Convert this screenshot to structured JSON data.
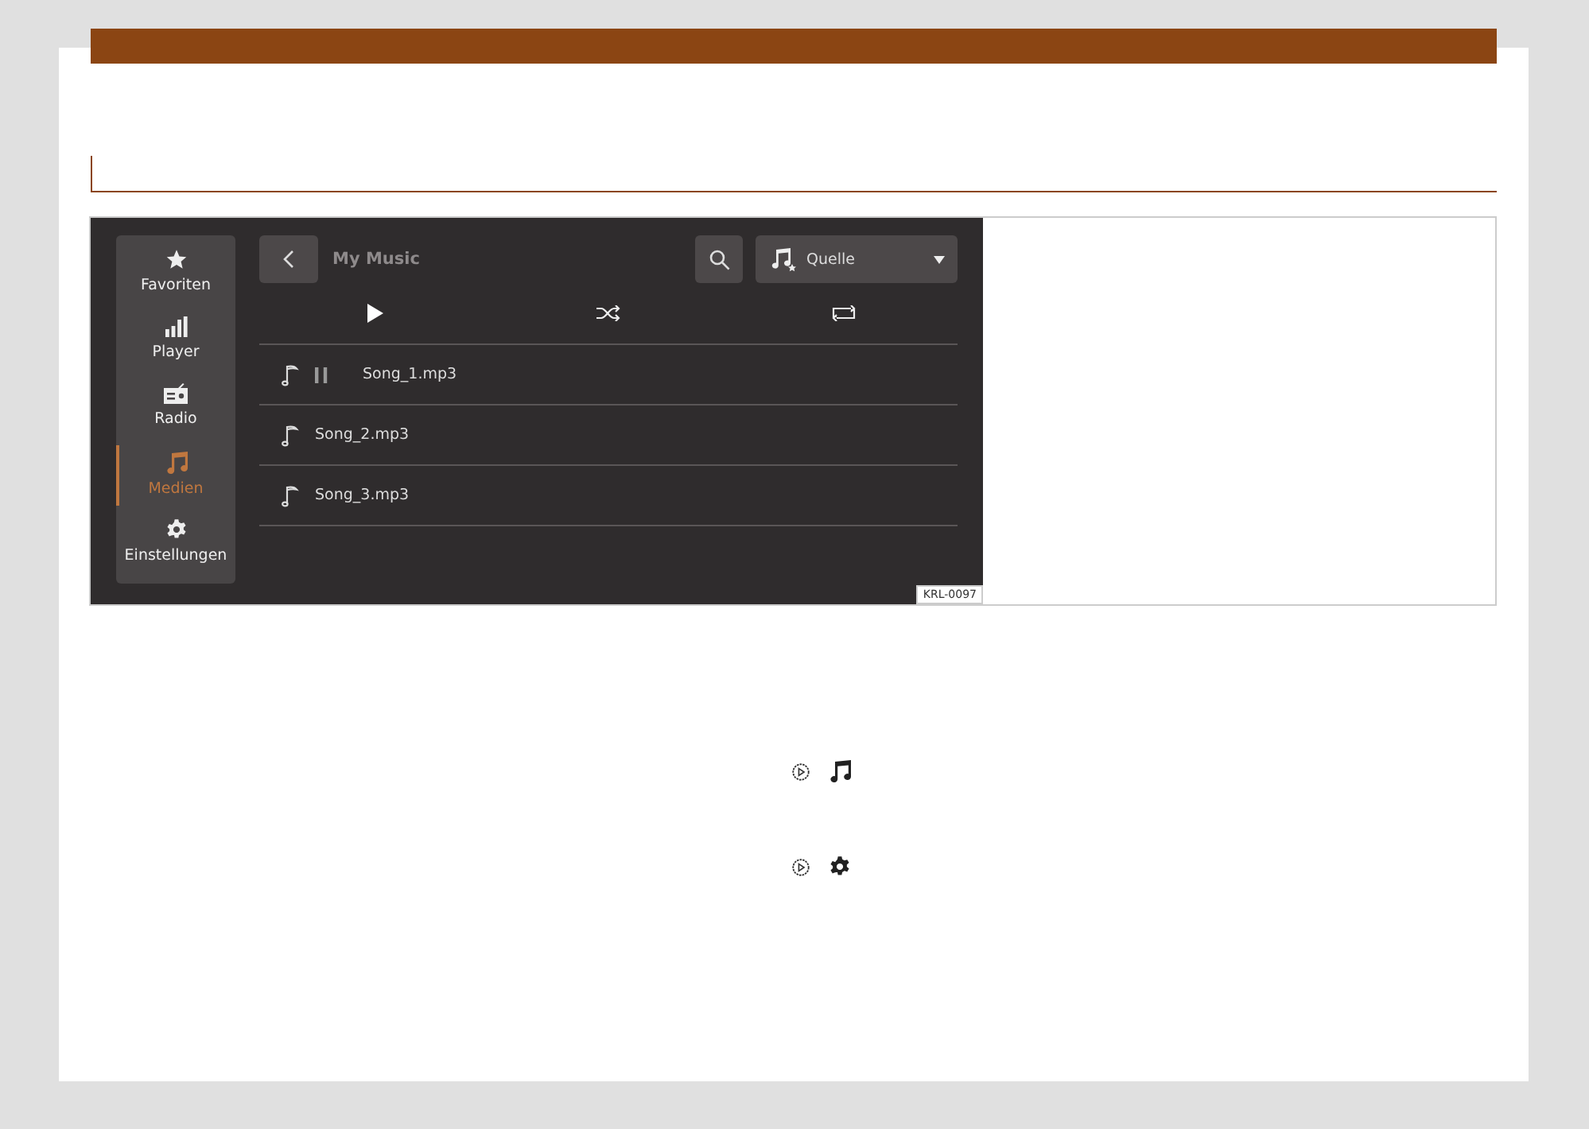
{
  "sidebar": {
    "items": [
      {
        "label": "Favoriten",
        "selected": false
      },
      {
        "label": "Player",
        "selected": false
      },
      {
        "label": "Radio",
        "selected": false
      },
      {
        "label": "Medien",
        "selected": true
      },
      {
        "label": "Einstellungen",
        "selected": false
      }
    ]
  },
  "header": {
    "title": "My Music",
    "source": "Quelle"
  },
  "songs": [
    {
      "name": "Song_1.mp3",
      "playing": true
    },
    {
      "name": "Song_2.mp3",
      "playing": false
    },
    {
      "name": "Song_3.mp3",
      "playing": false
    }
  ],
  "figure_label": "KRL-0097"
}
